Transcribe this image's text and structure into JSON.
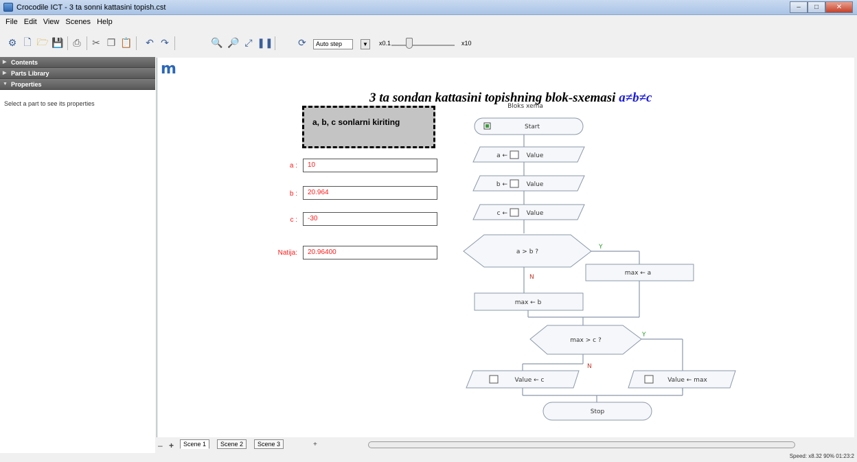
{
  "window": {
    "title": "Crocodile ICT - 3 ta sonni kattasini topish.cst",
    "min_label": "–",
    "max_label": "□",
    "close_label": "✕"
  },
  "menu": [
    "File",
    "Edit",
    "View",
    "Scenes",
    "Help"
  ],
  "toolbar": {
    "step_mode": "Auto step",
    "speed_min": "x0.1",
    "speed_max": "x10",
    "icons": [
      "open-folder",
      "new-document",
      "open-file",
      "save",
      "print",
      "cut",
      "copy",
      "paste",
      "undo",
      "redo",
      "zoom-in",
      "zoom-out",
      "fit",
      "pause",
      "run-step"
    ]
  },
  "sidebar": {
    "sections": [
      {
        "label": "Contents",
        "open": false
      },
      {
        "label": "Parts Library",
        "open": false
      },
      {
        "label": "Properties",
        "open": true
      }
    ],
    "message": "Select a part to see its properties"
  },
  "canvas": {
    "logo": "m",
    "title_prefix": "3 ta sondan kattasini topishning blok-sxemasi ",
    "title_suffix": "a≠b≠c",
    "input_block": "a, b, c sonlarni kiriting",
    "vars": [
      {
        "label": "a :",
        "value": "10"
      },
      {
        "label": "b :",
        "value": "20.964"
      },
      {
        "label": "c :",
        "value": "-30"
      }
    ],
    "result": {
      "label": "Natija:",
      "value": "20.96400"
    }
  },
  "flowchart": {
    "title": "Bloks xema",
    "start": "Start",
    "inputs": [
      "a ←",
      "b ←",
      "c ←"
    ],
    "value_label": "Value",
    "cond1": "a > b ?",
    "cond2": "max > c ?",
    "yes": "Y",
    "no": "N",
    "assign_a": "max ← a",
    "assign_b": "max ← b",
    "out_c": "Value ← c",
    "out_max": "Value ← max",
    "stop": "Stop",
    "colors": {
      "yes": "#2a9a2a",
      "no": "#c0392b",
      "line": "#8a98aa"
    }
  },
  "scenes": {
    "tabs": [
      "Scene 1",
      "Scene 2",
      "Scene 3"
    ],
    "active": 0,
    "remove": "–",
    "add": "+",
    "more": "+"
  },
  "status": "Speed: x8.32  90%   01:23:2"
}
